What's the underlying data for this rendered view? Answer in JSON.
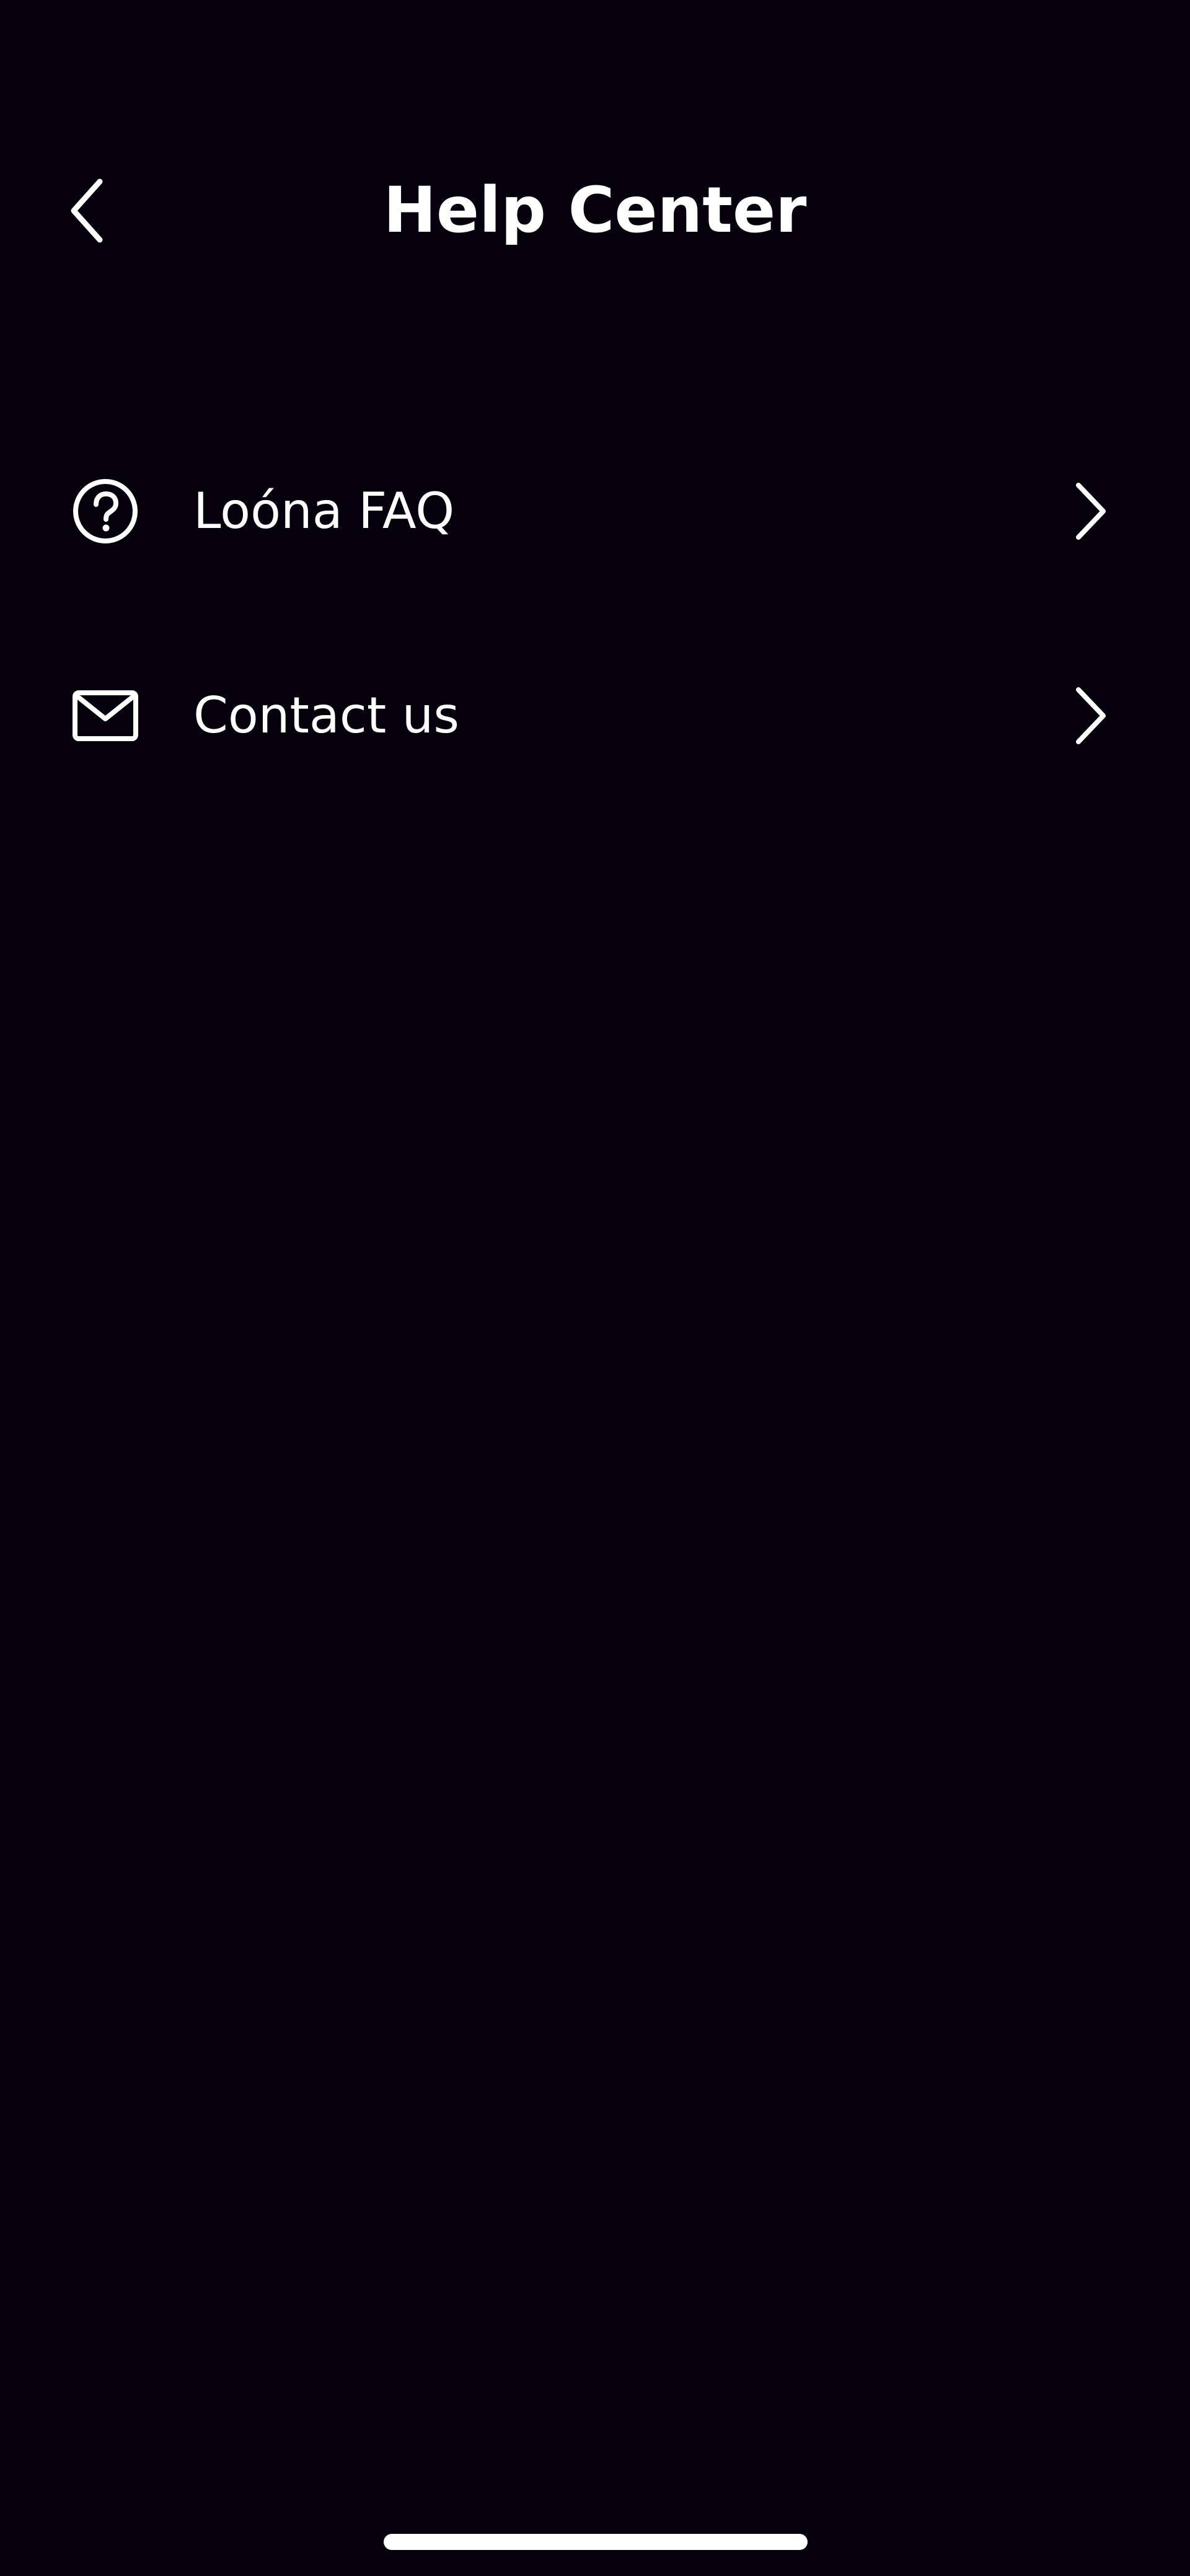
{
  "header": {
    "title": "Help Center",
    "back_icon": "chevron-left-icon"
  },
  "menu": {
    "items": [
      {
        "label": "Loóna FAQ",
        "icon": "question-circle-icon",
        "trailing_icon": "chevron-right-icon"
      },
      {
        "label": "Contact us",
        "icon": "envelope-icon",
        "trailing_icon": "chevron-right-icon"
      }
    ]
  },
  "colors": {
    "background": "#04000c",
    "foreground": "#ffffff"
  }
}
